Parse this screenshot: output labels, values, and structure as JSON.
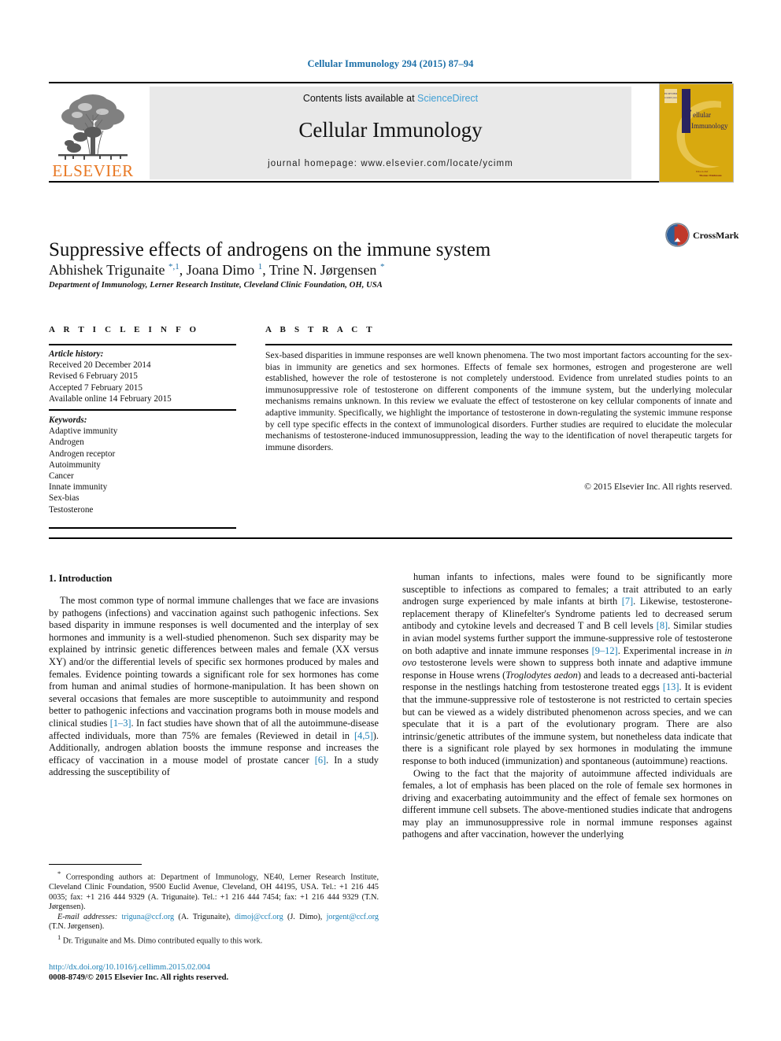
{
  "running_head": "Cellular Immunology 294 (2015) 87–94",
  "banner": {
    "contents_prefix": "Contents lists available at ",
    "sciencedirect": "ScienceDirect",
    "journal_title": "Cellular Immunology",
    "homepage": "journal homepage: www.elsevier.com/locate/ycimm",
    "publisher_wordmark": "ELSEVIER",
    "cover_title_line1": "ellular",
    "cover_title_line2": "Immunology"
  },
  "article": {
    "title": "Suppressive effects of androgens on the immune system",
    "authors_html": "Abhishek Trigunaite <sup>*,1</sup>, Joana Dimo <sup>1</sup>, Trine N. Jørgensen <sup>*</sup>",
    "affiliation": "Department of Immunology, Lerner Research Institute, Cleveland Clinic Foundation, OH, USA",
    "crossmark_label": "CrossMark"
  },
  "article_info": {
    "heading": "A R T I C L E   I N F O",
    "history_label": "Article history:",
    "history": [
      "Received 20 December 2014",
      "Revised 6 February 2015",
      "Accepted 7 February 2015",
      "Available online 14 February 2015"
    ],
    "keywords_label": "Keywords:",
    "keywords": [
      "Adaptive immunity",
      "Androgen",
      "Androgen receptor",
      "Autoimmunity",
      "Cancer",
      "Innate immunity",
      "Sex-bias",
      "Testosterone"
    ]
  },
  "abstract": {
    "heading": "A B S T R A C T",
    "text": "Sex-based disparities in immune responses are well known phenomena. The two most important factors accounting for the sex-bias in immunity are genetics and sex hormones. Effects of female sex hormones, estrogen and progesterone are well established, however the role of testosterone is not completely understood. Evidence from unrelated studies points to an immunosuppressive role of testosterone on different components of the immune system, but the underlying molecular mechanisms remains unknown. In this review we evaluate the effect of testosterone on key cellular components of innate and adaptive immunity. Specifically, we highlight the importance of testosterone in down-regulating the systemic immune response by cell type specific effects in the context of immunological disorders. Further studies are required to elucidate the molecular mechanisms of testosterone-induced immunosuppression, leading the way to the identification of novel therapeutic targets for immune disorders.",
    "copyright": "© 2015 Elsevier Inc. All rights reserved."
  },
  "body": {
    "section_heading": "1. Introduction",
    "left_column_html": "The most common type of normal immune challenges that we face are invasions by pathogens (infections) and vaccination against such pathogenic infections. Sex based disparity in immune responses is well documented and the interplay of sex hormones and immunity is a well-studied phenomenon. Such sex disparity may be explained by intrinsic genetic differences between males and female (XX versus XY) and/or the differential levels of specific sex hormones produced by males and females. Evidence pointing towards a significant role for sex hormones has come from human and animal studies of hormone-manipulation. It has been shown on several occasions that females are more susceptible to autoimmunity and respond better to pathogenic infections and vaccination programs both in mouse models and clinical studies <span class=\"ref\">[1–3]</span>. In fact studies have shown that of all the autoimmune-disease affected individuals, more than 75% are females (Reviewed in detail in <span class=\"ref\">[4,5]</span>). Additionally, androgen ablation boosts the immune response and increases the efficacy of vaccination in a mouse model of prostate cancer <span class=\"ref\">[6]</span>. In a study addressing the susceptibility of",
    "right_column_html_1": "human infants to infections, males were found to be significantly more susceptible to infections as compared to females; a trait attributed to an early androgen surge experienced by male infants at birth <span class=\"ref\">[7]</span>. Likewise, testosterone-replacement therapy of Klinefelter's Syndrome patients led to decreased serum antibody and cytokine levels and decreased T and B cell levels <span class=\"ref\">[8]</span>. Similar studies in avian model systems further support the immune-suppressive role of testosterone on both adaptive and innate immune responses <span class=\"ref\">[9–12]</span>. Experimental increase in <em>in ovo</em> testosterone levels were shown to suppress both innate and adaptive immune response in House wrens (<em>Troglodytes aedon</em>) and leads to a decreased anti-bacterial response in the nestlings hatching from testosterone treated eggs <span class=\"ref\">[13]</span>. It is evident that the immune-suppressive role of testosterone is not restricted to certain species but can be viewed as a widely distributed phenomenon across species, and we can speculate that it is a part of the evolutionary program. There are also intrinsic/genetic attributes of the immune system, but nonetheless data indicate that there is a significant role played by sex hormones in modulating the immune response to both induced (immunization) and spontaneous (autoimmune) reactions.",
    "right_column_html_2": "Owing to the fact that the majority of autoimmune affected individuals are females, a lot of emphasis has been placed on the role of female sex hormones in driving and exacerbating autoimmunity and the effect of female sex hormones on different immune cell subsets. The above-mentioned studies indicate that androgens may play an immunosuppressive role in normal immune responses against pathogens and after vaccination, however the underlying"
  },
  "footnotes": {
    "corresponding_html": "<sup>*</sup> Corresponding authors at: Department of Immunology, NE40, Lerner Research Institute, Cleveland Clinic Foundation, 9500 Euclid Avenue, Cleveland, OH 44195, USA. Tel.: +1 216 445 0035; fax: +1 216 444 9329 (A. Trigunaite). Tel.: +1 216 444 7454; fax: +1 216 444 9329 (T.N. Jørgensen).",
    "email_html": "<em>E-mail addresses:</em> <span class=\"mail\">triguna@ccf.org</span> (A. Trigunaite), <span class=\"mail\">dimoj@ccf.org</span> (J. Dimo), <span class=\"mail\">jorgent@ccf.org</span> (T.N. Jørgensen).",
    "equal_contrib_html": "<sup>1</sup> Dr. Trigunaite and Ms. Dimo contributed equally to this work.",
    "doi": "http://dx.doi.org/10.1016/j.cellimm.2015.02.004",
    "issn_line": "0008-8749/© 2015 Elsevier Inc. All rights reserved."
  },
  "colors": {
    "link_blue": "#1b7fb5",
    "header_blue": "#1b6fa8",
    "sciencedirect_blue": "#3f9fd5",
    "elsevier_orange": "#e87722",
    "cover_gold": "#d8a90f",
    "band_grey": "#e9e9e9"
  }
}
